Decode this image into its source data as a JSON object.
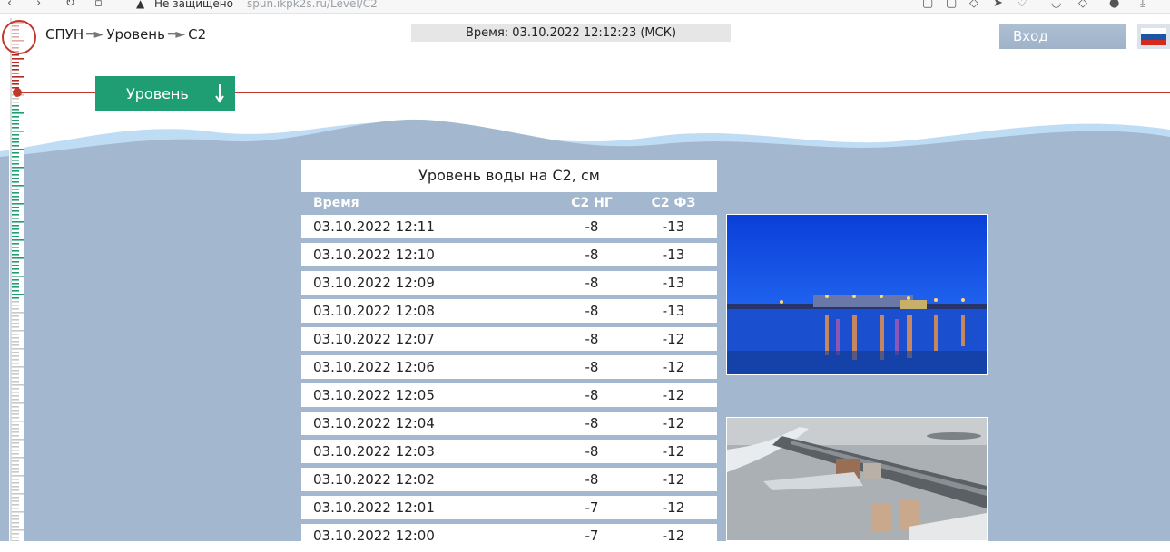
{
  "browser": {
    "security_label": "Не защищено",
    "url": "spun.ikpk2s.ru/Level/C2"
  },
  "header": {
    "breadcrumb": [
      "СПУН",
      "Уровень",
      "С2"
    ],
    "time_text": "Время: 03.10.2022 12:12:23 (МСК)",
    "login_label": "Вход",
    "language_icon": "russia-flag-icon"
  },
  "nav": {
    "level_button_label": "Уровень",
    "level_button_icon": "arrow-down-icon"
  },
  "table": {
    "title": "Уровень воды на С2, см",
    "columns": [
      "Время",
      "С2 НГ",
      "С2 ФЗ"
    ],
    "rows": [
      [
        "03.10.2022 12:11",
        "-8",
        "-13"
      ],
      [
        "03.10.2022 12:10",
        "-8",
        "-13"
      ],
      [
        "03.10.2022 12:09",
        "-8",
        "-13"
      ],
      [
        "03.10.2022 12:08",
        "-8",
        "-13"
      ],
      [
        "03.10.2022 12:07",
        "-8",
        "-12"
      ],
      [
        "03.10.2022 12:06",
        "-8",
        "-12"
      ],
      [
        "03.10.2022 12:05",
        "-8",
        "-12"
      ],
      [
        "03.10.2022 12:04",
        "-8",
        "-12"
      ],
      [
        "03.10.2022 12:03",
        "-8",
        "-12"
      ],
      [
        "03.10.2022 12:02",
        "-8",
        "-12"
      ],
      [
        "03.10.2022 12:01",
        "-7",
        "-12"
      ],
      [
        "03.10.2022 12:00",
        "-7",
        "-12"
      ]
    ]
  },
  "photos": [
    {
      "icon": "dam-night-photo"
    },
    {
      "icon": "dam-aerial-photo"
    }
  ],
  "colors": {
    "accent_green": "#1f9e74",
    "water": "#a3b8cf",
    "water_light": "#bfdcf5",
    "level_line": "#c0392b"
  }
}
